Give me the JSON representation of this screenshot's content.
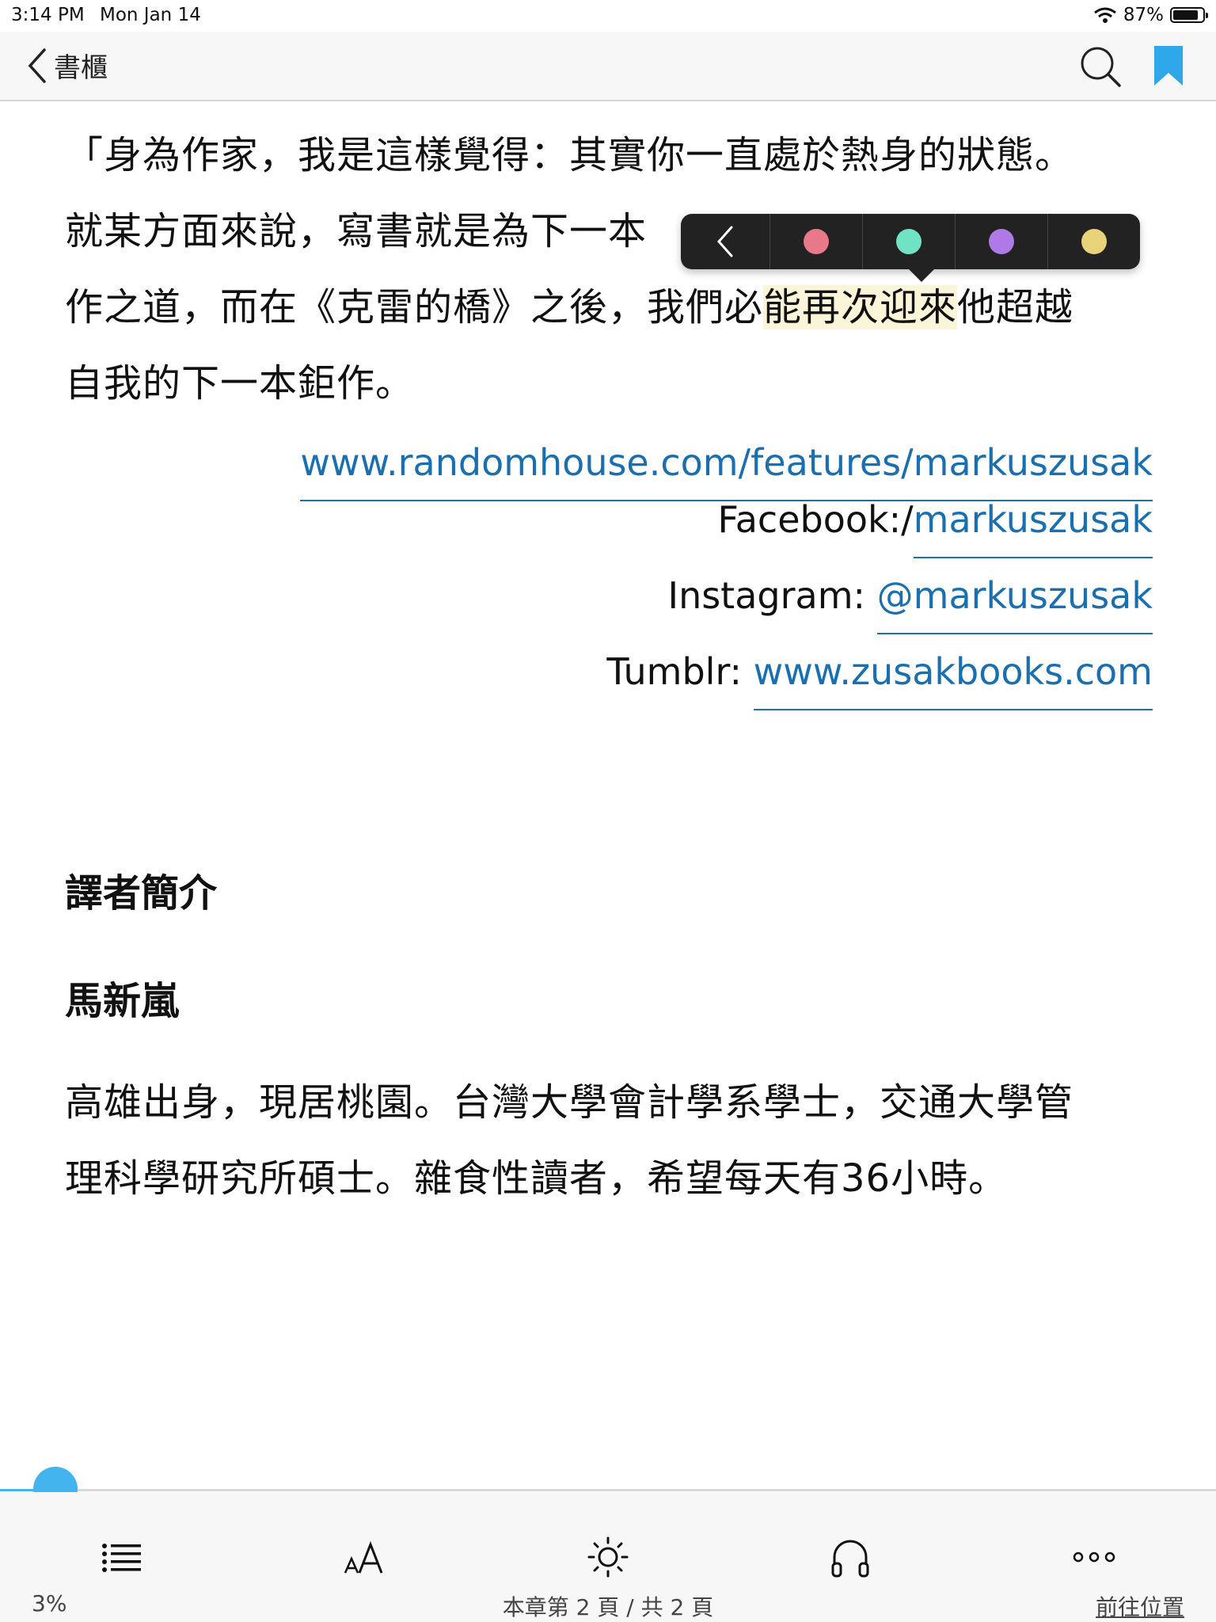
{
  "status_bar": {
    "time": "3:14 PM",
    "date": "Mon Jan 14",
    "battery_percent": "87%",
    "battery_level": 0.87
  },
  "nav": {
    "back_label": "書櫃"
  },
  "content": {
    "quote_paragraph": {
      "line1": "「身為作家，我是這樣覺得：其實你一直處於熱身的狀態。",
      "line2": "就某方面來說，寫書就是為下一本",
      "line3_before": "作之道，而在《克雷的橋》之後，我們必",
      "line3_highlight": "能再次迎來",
      "line3_after": "他超越",
      "line4": "自我的下一本鉅作。"
    },
    "links": {
      "website": "www.randomhouse.com/features/markuszusak",
      "facebook_label": "Facebook:/",
      "facebook_handle": "markuszusak",
      "instagram_label": "Instagram: ",
      "instagram_handle": "@markuszusak",
      "tumblr_label": "Tumblr: ",
      "tumblr_url": "www.zusakbooks.com"
    },
    "translator_heading": "譯者簡介",
    "translator_name": "馬新嵐",
    "bio_line1": "高雄出身，現居桃園。台灣大學會計學系學士，交通大學管",
    "bio_line2": "理科學研究所碩士。雜食性讀者，希望每天有36小時。"
  },
  "highlight_popup": {
    "colors": [
      "#e8788a",
      "#6fe3c4",
      "#b07ae6",
      "#e8d27a"
    ],
    "icons": [
      "chevron-left-icon",
      "red-dot",
      "green-dot",
      "purple-dot",
      "yellow-dot"
    ]
  },
  "progress": {
    "percent_label": "3%",
    "value": 0.03
  },
  "footer": {
    "page_info": "本章第 2 頁 / 共 2 頁",
    "goto_label": "前往位置"
  },
  "colors": {
    "accent": "#43b4ee",
    "link": "#1a6fb0",
    "bookmark": "#2ea8ea",
    "highlight": "#faf4d8"
  }
}
